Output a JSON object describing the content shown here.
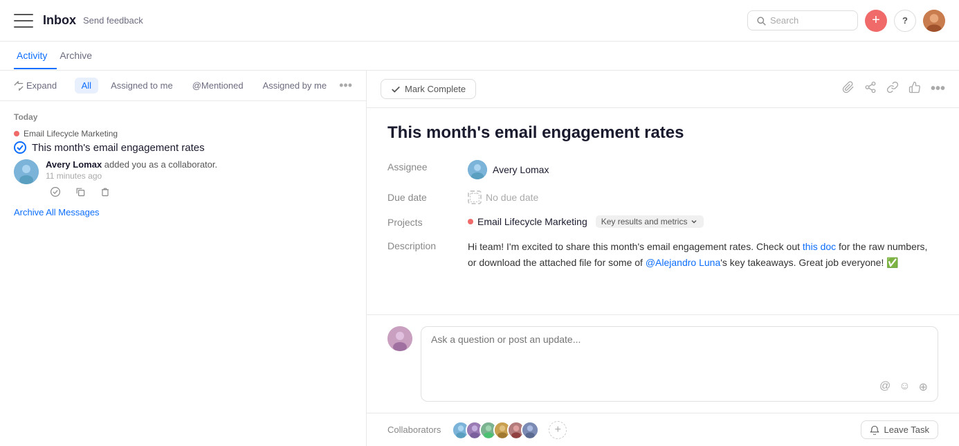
{
  "header": {
    "title": "Inbox",
    "send_feedback": "Send feedback",
    "search_placeholder": "Search"
  },
  "tabs": {
    "items": [
      {
        "label": "Activity",
        "active": true
      },
      {
        "label": "Archive",
        "active": false
      }
    ]
  },
  "filter_bar": {
    "expand_label": "Expand",
    "filters": [
      "All",
      "Assigned to me",
      "@Mentioned",
      "Assigned by me"
    ],
    "active_filter": "All",
    "more_icon": "•••"
  },
  "left_panel": {
    "section_label": "Today",
    "notification": {
      "project_tag": "Email Lifecycle Marketing",
      "task_title": "This month's email engagement rates",
      "activity_user": "Avery Lomax",
      "activity_text": " added you as a collaborator.",
      "timestamp": "11 minutes ago"
    },
    "archive_all": "Archive All Messages"
  },
  "right_panel": {
    "mark_complete": "Mark Complete",
    "task_title": "This month's email engagement rates",
    "assignee_label": "Assignee",
    "assignee_name": "Avery Lomax",
    "due_date_label": "Due date",
    "due_date_value": "No due date",
    "projects_label": "Projects",
    "project_name": "Email Lifecycle Marketing",
    "key_results_label": "Key results and metrics",
    "description_label": "Description",
    "description_part1": "Hi team! I'm excited to share this month's email engagement rates. Check out ",
    "description_link": "this doc",
    "description_part2": " for the raw numbers, or download the attached file for some of ",
    "description_mention": "@Alejandro Luna",
    "description_part3": "'s key takeaways. Great job everyone! ✅",
    "comment_placeholder": "Ask a question or post an update...",
    "collaborators_label": "Collaborators",
    "leave_task_label": "Leave Task"
  }
}
